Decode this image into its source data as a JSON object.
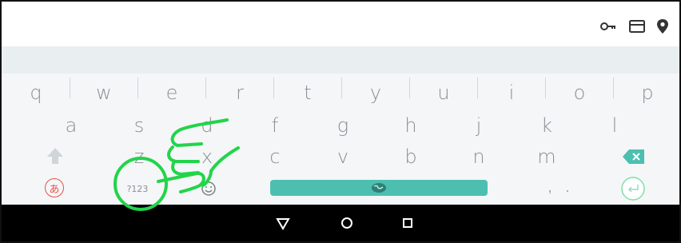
{
  "status_bar": {
    "icons": [
      "key-icon",
      "card-icon",
      "location-pin-icon"
    ]
  },
  "keyboard": {
    "row1": [
      "q",
      "w",
      "e",
      "r",
      "t",
      "y",
      "u",
      "i",
      "o",
      "p"
    ],
    "row2": [
      "a",
      "s",
      "d",
      "f",
      "g",
      "h",
      "j",
      "k",
      "l"
    ],
    "row3": [
      "z",
      "x",
      "c",
      "v",
      "b",
      "n",
      "m"
    ],
    "bottom": {
      "lang_label": "あ",
      "symbols_label": "?123",
      "comma": ",",
      "period": "."
    },
    "accent_color": "#4dbfb0",
    "lang_color": "#e8504a"
  },
  "nav": {
    "icons": [
      "back-triangle-icon",
      "home-circle-icon",
      "recents-square-icon"
    ]
  },
  "overlay": {
    "icons": [
      "pointing-hand-icon",
      "highlight-circle-icon"
    ],
    "color": "#22d44a"
  }
}
